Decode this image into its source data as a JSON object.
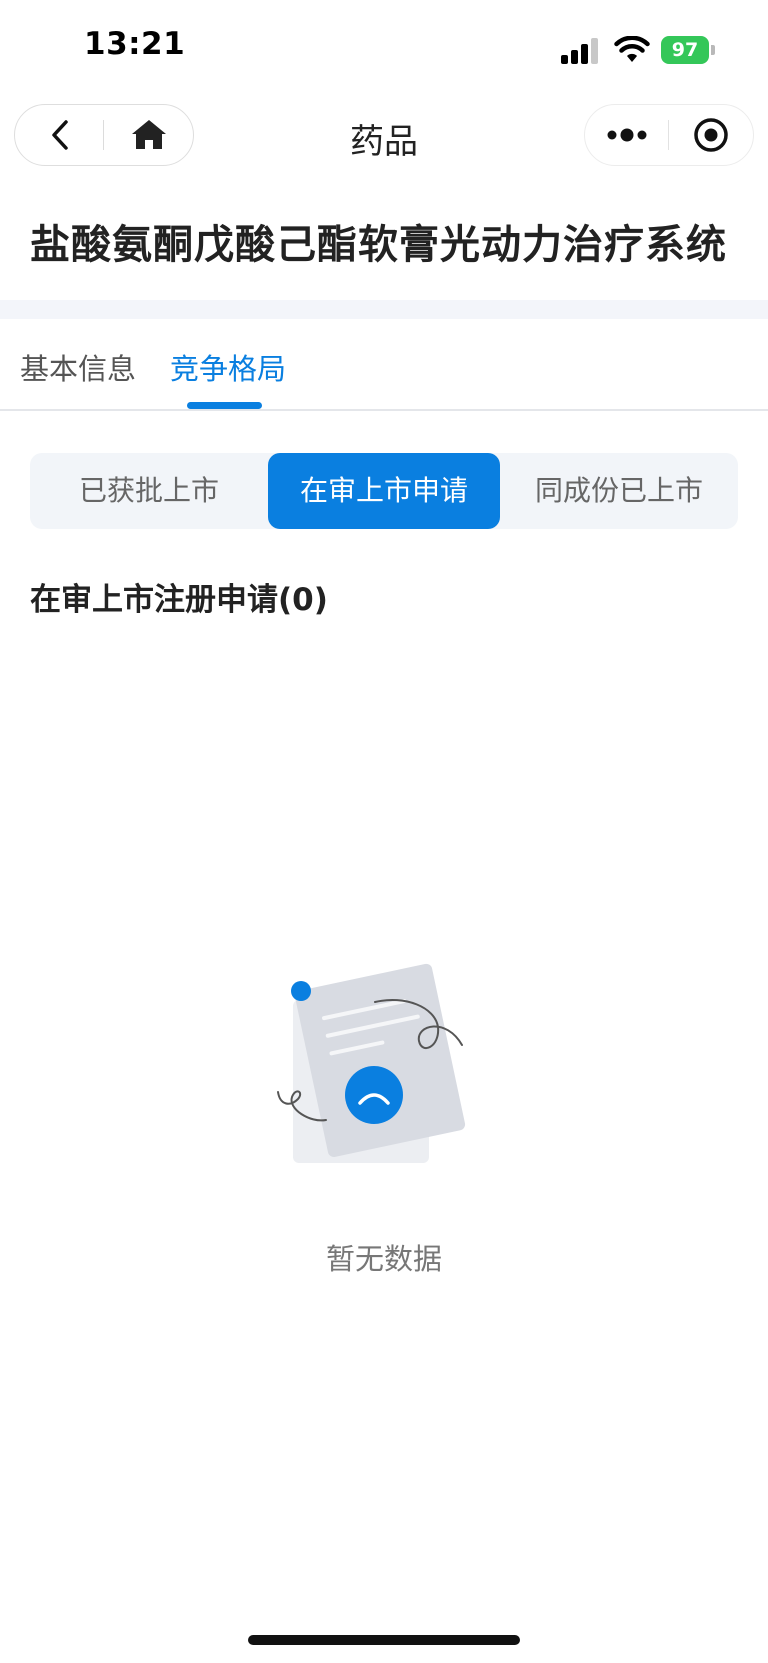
{
  "status_bar": {
    "time": "13:21",
    "battery_percent": "97",
    "battery_color": "#34c759"
  },
  "nav": {
    "title": "药品",
    "icons": [
      "back-icon",
      "home-icon",
      "more-icon",
      "target-icon"
    ]
  },
  "header": {
    "drug_name": "盐酸氨酮戊酸己酯软膏光动力治疗系统"
  },
  "tabs": [
    {
      "label": "基本信息",
      "active": false
    },
    {
      "label": "竞争格局",
      "active": true
    }
  ],
  "segments": [
    {
      "label": "已获批上市",
      "active": false
    },
    {
      "label": "在审上市申请",
      "active": true
    },
    {
      "label": "同成份已上市",
      "active": false
    }
  ],
  "section": {
    "title": "在审上市注册申请(0)"
  },
  "empty_state": {
    "text": "暂无数据",
    "icon": "sad-document-illustration"
  },
  "colors": {
    "accent": "#0a7fe0",
    "segment_bg": "#f2f5f9",
    "band": "#f3f5fa"
  }
}
